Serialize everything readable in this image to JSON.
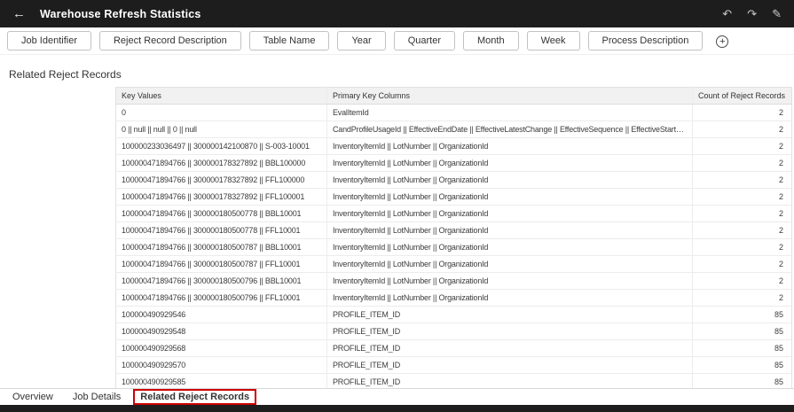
{
  "header": {
    "title": "Warehouse Refresh Statistics",
    "back_glyph": "←",
    "undo_glyph": "↶",
    "redo_glyph": "↷",
    "edit_glyph": "✎"
  },
  "filter_bar": {
    "buttons": [
      "Job Identifier",
      "Reject Record Description",
      "Table Name",
      "Year",
      "Quarter",
      "Month",
      "Week",
      "Process Description"
    ],
    "add_glyph": "+"
  },
  "section_title": "Related Reject Records",
  "table": {
    "columns": [
      "Key Values",
      "Primary Key Columns",
      "Count of Reject Records"
    ],
    "rows": [
      {
        "key_values": "0",
        "primary_key_columns": "EvalItemId",
        "count": 2
      },
      {
        "key_values": "0 || null || null || 0 || null",
        "primary_key_columns": "CandProfileUsageId || EffectiveEndDate || EffectiveLatestChange || EffectiveSequence || EffectiveStartDate",
        "count": 2
      },
      {
        "key_values": "100000233036497 || 300000142100870 || S-003-10001",
        "primary_key_columns": "InventoryItemId || LotNumber || OrganizationId",
        "count": 2
      },
      {
        "key_values": "100000471894766 || 300000178327892 || BBL100000",
        "primary_key_columns": "InventoryItemId || LotNumber || OrganizationId",
        "count": 2
      },
      {
        "key_values": "100000471894766 || 300000178327892 || FFL100000",
        "primary_key_columns": "InventoryItemId || LotNumber || OrganizationId",
        "count": 2
      },
      {
        "key_values": "100000471894766 || 300000178327892 || FFL100001",
        "primary_key_columns": "InventoryItemId || LotNumber || OrganizationId",
        "count": 2
      },
      {
        "key_values": "100000471894766 || 300000180500778 || BBL10001",
        "primary_key_columns": "InventoryItemId || LotNumber || OrganizationId",
        "count": 2
      },
      {
        "key_values": "100000471894766 || 300000180500778 || FFL10001",
        "primary_key_columns": "InventoryItemId || LotNumber || OrganizationId",
        "count": 2
      },
      {
        "key_values": "100000471894766 || 300000180500787 || BBL10001",
        "primary_key_columns": "InventoryItemId || LotNumber || OrganizationId",
        "count": 2
      },
      {
        "key_values": "100000471894766 || 300000180500787 || FFL10001",
        "primary_key_columns": "InventoryItemId || LotNumber || OrganizationId",
        "count": 2
      },
      {
        "key_values": "100000471894766 || 300000180500796 || BBL10001",
        "primary_key_columns": "InventoryItemId || LotNumber || OrganizationId",
        "count": 2
      },
      {
        "key_values": "100000471894766 || 300000180500796 || FFL10001",
        "primary_key_columns": "InventoryItemId || LotNumber || OrganizationId",
        "count": 2
      },
      {
        "key_values": "100000490929546",
        "primary_key_columns": "PROFILE_ITEM_ID",
        "count": 85
      },
      {
        "key_values": "100000490929548",
        "primary_key_columns": "PROFILE_ITEM_ID",
        "count": 85
      },
      {
        "key_values": "100000490929568",
        "primary_key_columns": "PROFILE_ITEM_ID",
        "count": 85
      },
      {
        "key_values": "100000490929570",
        "primary_key_columns": "PROFILE_ITEM_ID",
        "count": 85
      },
      {
        "key_values": "100000490929585",
        "primary_key_columns": "PROFILE_ITEM_ID",
        "count": 85
      }
    ]
  },
  "footer_tabs": [
    {
      "label": "Overview",
      "active": false
    },
    {
      "label": "Job Details",
      "active": false
    },
    {
      "label": "Related Reject Records",
      "active": true
    }
  ],
  "colors": {
    "topbar": "#1d1d1d",
    "annotation": "#cc0000"
  }
}
